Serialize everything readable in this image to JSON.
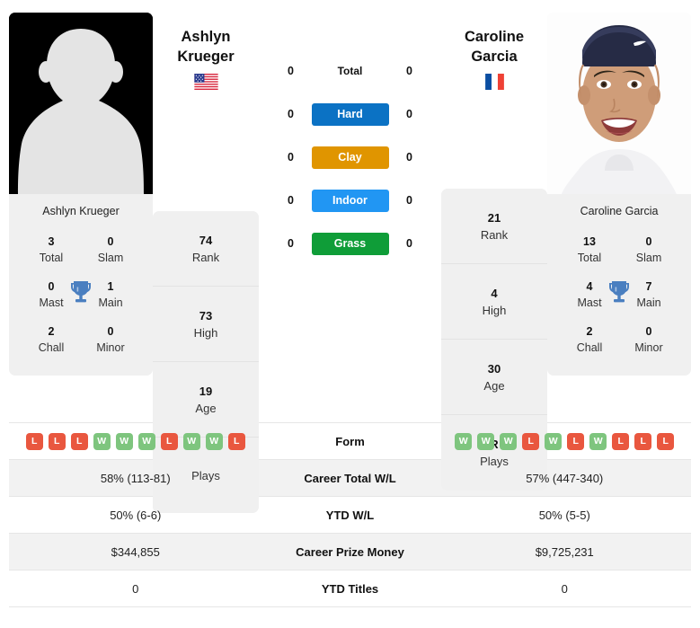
{
  "players": {
    "left": {
      "name_line1": "Ashlyn",
      "name_line2": "Krueger",
      "full_name": "Ashlyn Krueger",
      "country": "USA",
      "flag_icon": "flag-usa",
      "photo_type": "placeholder-avatar",
      "titles": {
        "total_value": "3",
        "total_label": "Total",
        "slam_value": "0",
        "slam_label": "Slam",
        "mast_value": "0",
        "mast_label": "Mast",
        "main_value": "1",
        "main_label": "Main",
        "chall_value": "2",
        "chall_label": "Chall",
        "minor_value": "0",
        "minor_label": "Minor"
      },
      "stats": [
        {
          "value": "74",
          "label": "Rank"
        },
        {
          "value": "73",
          "label": "High"
        },
        {
          "value": "19",
          "label": "Age"
        },
        {
          "value": "",
          "label": "Plays"
        }
      ],
      "surface_wins": {
        "total": "0",
        "hard": "0",
        "clay": "0",
        "indoor": "0",
        "grass": "0"
      },
      "form": [
        "L",
        "L",
        "L",
        "W",
        "W",
        "W",
        "L",
        "W",
        "W",
        "L"
      ],
      "career_total_wl": "58% (113-81)",
      "ytd_wl": "50% (6-6)",
      "career_prize_money": "$344,855",
      "ytd_titles": "0"
    },
    "right": {
      "name_line1": "Caroline",
      "name_line2": "Garcia",
      "full_name": "Caroline Garcia",
      "country": "FRA",
      "flag_icon": "flag-france",
      "photo_type": "player-photo",
      "titles": {
        "total_value": "13",
        "total_label": "Total",
        "slam_value": "0",
        "slam_label": "Slam",
        "mast_value": "4",
        "mast_label": "Mast",
        "main_value": "7",
        "main_label": "Main",
        "chall_value": "2",
        "chall_label": "Chall",
        "minor_value": "0",
        "minor_label": "Minor"
      },
      "stats": [
        {
          "value": "21",
          "label": "Rank"
        },
        {
          "value": "4",
          "label": "High"
        },
        {
          "value": "30",
          "label": "Age"
        },
        {
          "value": "R",
          "label": "Plays"
        }
      ],
      "surface_wins": {
        "total": "0",
        "hard": "0",
        "clay": "0",
        "indoor": "0",
        "grass": "0"
      },
      "form": [
        "W",
        "W",
        "W",
        "L",
        "W",
        "L",
        "W",
        "L",
        "L",
        "L"
      ],
      "career_total_wl": "57% (447-340)",
      "ytd_wl": "50% (5-5)",
      "career_prize_money": "$9,725,231",
      "ytd_titles": "0"
    }
  },
  "surfaces": [
    {
      "key": "total",
      "label": "Total",
      "type": "plain",
      "color": ""
    },
    {
      "key": "hard",
      "label": "Hard",
      "type": "badge",
      "color": "#0b72c4"
    },
    {
      "key": "clay",
      "label": "Clay",
      "type": "badge",
      "color": "#e09500"
    },
    {
      "key": "indoor",
      "label": "Indoor",
      "type": "badge",
      "color": "#2196f3"
    },
    {
      "key": "grass",
      "label": "Grass",
      "type": "badge",
      "color": "#0f9d38"
    }
  ],
  "table_rows": [
    {
      "label": "Form",
      "type": "form"
    },
    {
      "label": "Career Total W/L",
      "type": "text",
      "key": "career_total_wl"
    },
    {
      "label": "YTD W/L",
      "type": "text",
      "key": "ytd_wl"
    },
    {
      "label": "Career Prize Money",
      "type": "text",
      "key": "career_prize_money"
    },
    {
      "label": "YTD Titles",
      "type": "text",
      "key": "ytd_titles"
    }
  ],
  "colors": {
    "win_badge": "#7ec57e",
    "loss_badge": "#e9573f",
    "card_bg": "#f0f0f0",
    "alt_row_bg": "#f2f2f2",
    "trophy": "#4a7fc0"
  }
}
